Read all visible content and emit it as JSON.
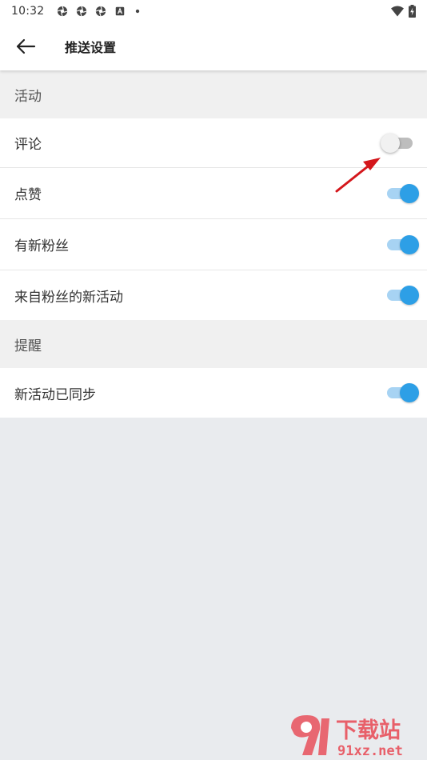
{
  "status_bar": {
    "time": "10:32",
    "notification_icons": [
      "aperture-icon",
      "aperture-icon",
      "aperture-icon",
      "keyboard-a-icon",
      "dot-icon"
    ],
    "right_icons": [
      "wifi-icon",
      "battery-charging-icon"
    ]
  },
  "app_bar": {
    "title": "推送设置"
  },
  "sections": [
    {
      "header": "活动",
      "rows": [
        {
          "label": "评论",
          "on": false
        },
        {
          "label": "点赞",
          "on": true
        },
        {
          "label": "有新粉丝",
          "on": true
        },
        {
          "label": "来自粉丝的新活动",
          "on": true
        }
      ]
    },
    {
      "header": "提醒",
      "rows": [
        {
          "label": "新活动已同步",
          "on": true
        }
      ]
    }
  ],
  "colors": {
    "accent": "#2d9fe6",
    "track_on": "#a7d3f3",
    "annotation_arrow": "#d4161b"
  },
  "watermark": {
    "main": "下载站",
    "sub": "91xz.net"
  }
}
